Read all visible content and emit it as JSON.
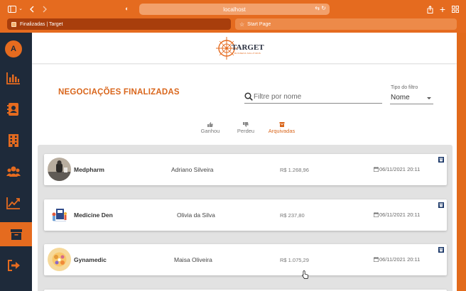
{
  "browser": {
    "url": "localhost",
    "tabs": [
      {
        "label": "Finalizadas | Target"
      },
      {
        "label": "Start Page"
      }
    ]
  },
  "sidebar": {
    "avatar_letter": "A",
    "items": [
      {
        "icon": "bar-chart-icon"
      },
      {
        "icon": "contacts-icon"
      },
      {
        "icon": "building-icon"
      },
      {
        "icon": "users-icon"
      },
      {
        "icon": "trend-line-icon"
      },
      {
        "icon": "archive-icon",
        "active": true
      },
      {
        "icon": "logout-icon"
      }
    ]
  },
  "header": {
    "logo_text": "TARGET",
    "logo_sub": "BUSINESS SOLUTIONS"
  },
  "main": {
    "title": "NEGOCIAÇÕES FINALIZADAS",
    "search_placeholder": "Filtre por nome",
    "filter_label": "Tipo do filtro",
    "filter_value": "Nome",
    "filter_tabs": [
      {
        "label": "Ganhou"
      },
      {
        "label": "Perdeu"
      },
      {
        "label": "Arquivadas",
        "active": true
      }
    ],
    "negotiations": [
      {
        "company": "Medpharm",
        "person": "Adriano Silveira",
        "value": "R$ 1.268,96",
        "date": "06/11/2021 20:11"
      },
      {
        "company": "Medicine Den",
        "person": "Olivia da Silva",
        "value": "R$ 237,80",
        "date": "06/11/2021 20:11"
      },
      {
        "company": "Gynamedic",
        "person": "Maisa Oliveira",
        "value": "R$ 1.075,29",
        "date": "06/11/2021 20:11"
      }
    ]
  },
  "colors": {
    "brand_orange": "#e56b1f",
    "sidebar_navy": "#1e2a3a",
    "title_orange": "#d9661c"
  }
}
